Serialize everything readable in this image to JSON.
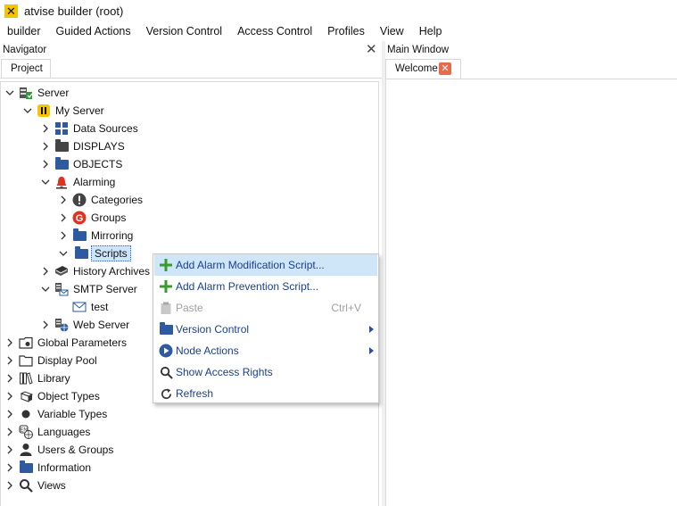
{
  "window": {
    "title": "atvise builder  (root)",
    "app_icon": "x-logo-icon"
  },
  "menubar": [
    "builder",
    "Guided Actions",
    "Version Control",
    "Access Control",
    "Profiles",
    "View",
    "Help"
  ],
  "navigator": {
    "title": "Navigator",
    "tab": "Project"
  },
  "main_window": {
    "title": "Main Window",
    "tab": "Welcome"
  },
  "tree": [
    {
      "label": "Server",
      "icon": "server-icon",
      "expanded": true
    },
    {
      "label": "My Server",
      "icon": "my-server-icon",
      "expanded": true
    },
    {
      "label": "Data Sources",
      "icon": "grid-icon",
      "expanded": false
    },
    {
      "label": "DISPLAYS",
      "icon": "folder-gray-icon",
      "expanded": false
    },
    {
      "label": "OBJECTS",
      "icon": "folder-icon",
      "expanded": false
    },
    {
      "label": "Alarming",
      "icon": "bell-icon",
      "expanded": true
    },
    {
      "label": "Categories",
      "icon": "exclamation-icon",
      "expanded": false
    },
    {
      "label": "Groups",
      "icon": "group-g-icon",
      "expanded": false
    },
    {
      "label": "Mirroring",
      "icon": "folder-icon",
      "expanded": false
    },
    {
      "label": "Scripts",
      "icon": "folder-icon",
      "expanded": true,
      "selected": true
    },
    {
      "label": "History Archives",
      "icon": "book-icon",
      "expanded": false
    },
    {
      "label": "SMTP Server",
      "icon": "smtp-server-icon",
      "expanded": true
    },
    {
      "label": "test",
      "icon": "envelope-icon"
    },
    {
      "label": "Web Server",
      "icon": "web-server-icon",
      "expanded": false
    },
    {
      "label": "Global Parameters",
      "icon": "global-params-icon",
      "expanded": false
    },
    {
      "label": "Display Pool",
      "icon": "folder-outline-icon",
      "expanded": false
    },
    {
      "label": "Library",
      "icon": "library-icon",
      "expanded": false
    },
    {
      "label": "Object Types",
      "icon": "object-types-icon",
      "expanded": false
    },
    {
      "label": "Variable Types",
      "icon": "dot-icon",
      "expanded": false
    },
    {
      "label": "Languages",
      "icon": "languages-icon",
      "expanded": false
    },
    {
      "label": "Users & Groups",
      "icon": "user-icon",
      "expanded": false
    },
    {
      "label": "Information",
      "icon": "folder-icon",
      "expanded": false
    },
    {
      "label": "Views",
      "icon": "magnifier-icon",
      "expanded": false
    }
  ],
  "context_menu": [
    {
      "label": "Add Alarm Modification Script...",
      "icon": "plus-icon",
      "highlighted": true
    },
    {
      "label": "Add Alarm Prevention Script...",
      "icon": "plus-icon"
    },
    {
      "label": "Paste",
      "icon": "clipboard-icon",
      "disabled": true,
      "shortcut": "Ctrl+V"
    },
    {
      "label": "Version Control",
      "icon": "folder-icon",
      "submenu": true
    },
    {
      "label": "Node Actions",
      "icon": "play-icon",
      "submenu": true
    },
    {
      "label": "Show Access Rights",
      "icon": "magnifier-icon"
    },
    {
      "label": "Refresh",
      "icon": "refresh-icon"
    }
  ],
  "colors": {
    "folder": "#2d5aa0",
    "accent_yellow": "#f5c400",
    "highlight": "#cfe6f8",
    "menu_text": "#1a3f8f",
    "alarm_red": "#e0321e"
  }
}
